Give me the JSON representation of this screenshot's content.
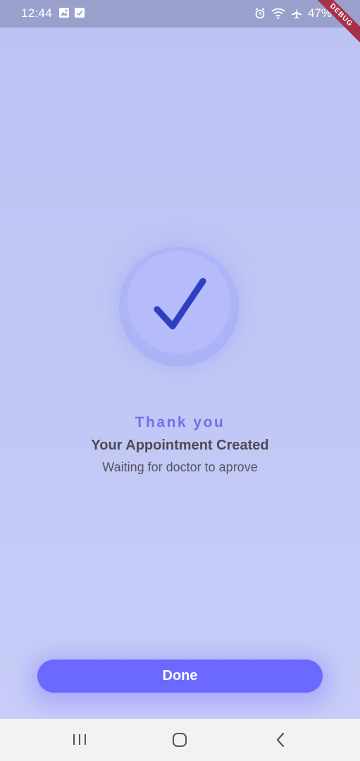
{
  "status_bar": {
    "time": "12:44",
    "left_icons": [
      "gallery-icon",
      "download-check-icon"
    ],
    "right_icons": [
      "alarm-icon",
      "wifi-icon",
      "airplane-icon"
    ],
    "battery": "47%"
  },
  "debug_banner": "DEBUG",
  "success": {
    "icon": "check-icon",
    "thanks": "Thank you",
    "title": "Your Appointment Created",
    "subtitle": "Waiting for doctor to aprove"
  },
  "actions": {
    "done_label": "Done"
  },
  "nav_bar": {
    "buttons": [
      "recent-apps-icon",
      "home-icon",
      "back-icon"
    ]
  },
  "colors": {
    "accent": "#6b69ff",
    "thanks_text": "#6e70e8",
    "check": "#2f3fbf",
    "background": "#c0c6f4"
  }
}
